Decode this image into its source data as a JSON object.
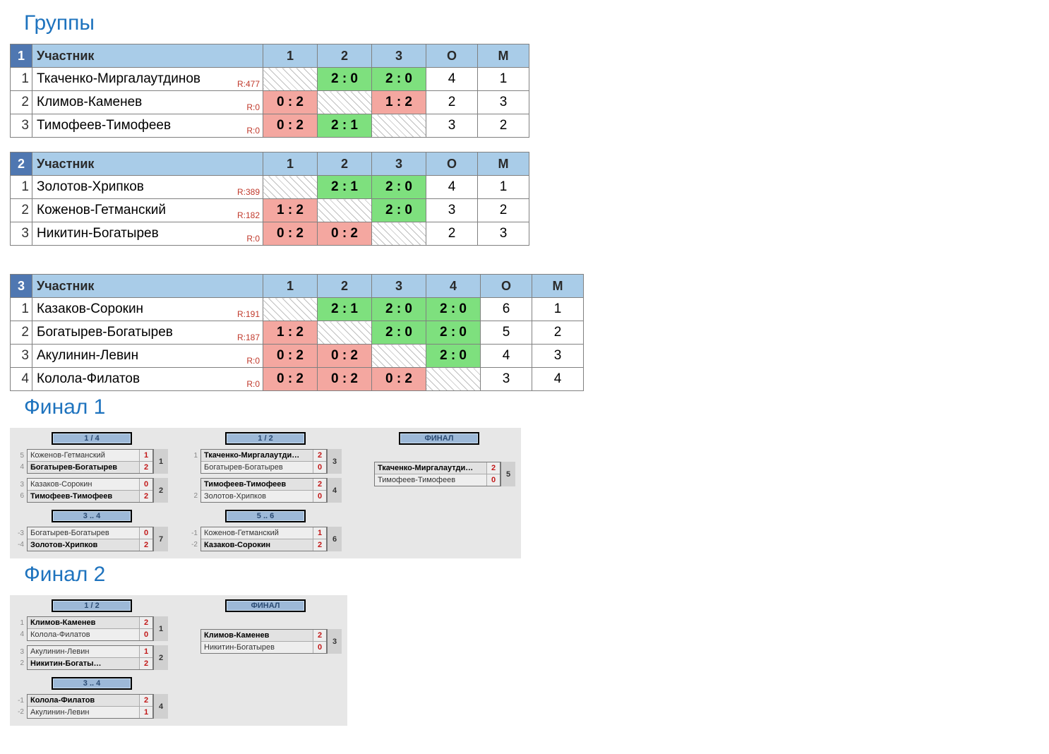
{
  "sections": {
    "groups": "Группы",
    "final1": "Финал 1",
    "final2": "Финал 2"
  },
  "headers": {
    "participant": "Участник",
    "o": "О",
    "m": "М"
  },
  "groups": [
    {
      "number": "1",
      "cols": [
        "1",
        "2",
        "3"
      ],
      "rows": [
        {
          "idx": "1",
          "name": "Ткаченко-Миргалаутдинов",
          "rating": "R:477",
          "cells": [
            {
              "t": "diag"
            },
            {
              "t": "win",
              "v": "2 : 0"
            },
            {
              "t": "win",
              "v": "2 : 0"
            }
          ],
          "o": "4",
          "m": "1"
        },
        {
          "idx": "2",
          "name": "Климов-Каменев",
          "rating": "R:0",
          "cells": [
            {
              "t": "lose",
              "v": "0 : 2"
            },
            {
              "t": "diag"
            },
            {
              "t": "lose",
              "v": "1 : 2"
            }
          ],
          "o": "2",
          "m": "3"
        },
        {
          "idx": "3",
          "name": "Тимофеев-Тимофеев",
          "rating": "R:0",
          "cells": [
            {
              "t": "lose",
              "v": "0 : 2"
            },
            {
              "t": "win",
              "v": "2 : 1"
            },
            {
              "t": "diag"
            }
          ],
          "o": "3",
          "m": "2"
        }
      ]
    },
    {
      "number": "2",
      "cols": [
        "1",
        "2",
        "3"
      ],
      "rows": [
        {
          "idx": "1",
          "name": "Золотов-Хрипков",
          "rating": "R:389",
          "cells": [
            {
              "t": "diag"
            },
            {
              "t": "win",
              "v": "2 : 1"
            },
            {
              "t": "win",
              "v": "2 : 0"
            }
          ],
          "o": "4",
          "m": "1"
        },
        {
          "idx": "2",
          "name": "Коженов-Гетманский",
          "rating": "R:182",
          "cells": [
            {
              "t": "lose",
              "v": "1 : 2"
            },
            {
              "t": "diag"
            },
            {
              "t": "win",
              "v": "2 : 0"
            }
          ],
          "o": "3",
          "m": "2"
        },
        {
          "idx": "3",
          "name": "Никитин-Богатырев",
          "rating": "R:0",
          "cells": [
            {
              "t": "lose",
              "v": "0 : 2"
            },
            {
              "t": "lose",
              "v": "0 : 2"
            },
            {
              "t": "diag"
            }
          ],
          "o": "2",
          "m": "3"
        }
      ]
    },
    {
      "number": "3",
      "cols": [
        "1",
        "2",
        "3",
        "4"
      ],
      "rows": [
        {
          "idx": "1",
          "name": "Казаков-Сорокин",
          "rating": "R:191",
          "cells": [
            {
              "t": "diag"
            },
            {
              "t": "win",
              "v": "2 : 1"
            },
            {
              "t": "win",
              "v": "2 : 0"
            },
            {
              "t": "win",
              "v": "2 : 0"
            }
          ],
          "o": "6",
          "m": "1"
        },
        {
          "idx": "2",
          "name": "Богатырев-Богатырев",
          "rating": "R:187",
          "cells": [
            {
              "t": "lose",
              "v": "1 : 2"
            },
            {
              "t": "diag"
            },
            {
              "t": "win",
              "v": "2 : 0"
            },
            {
              "t": "win",
              "v": "2 : 0"
            }
          ],
          "o": "5",
          "m": "2"
        },
        {
          "idx": "3",
          "name": "Акулинин-Левин",
          "rating": "R:0",
          "cells": [
            {
              "t": "lose",
              "v": "0 : 2"
            },
            {
              "t": "lose",
              "v": "0 : 2"
            },
            {
              "t": "diag"
            },
            {
              "t": "win",
              "v": "2 : 0"
            }
          ],
          "o": "4",
          "m": "3"
        },
        {
          "idx": "4",
          "name": "Колола-Филатов",
          "rating": "R:0",
          "cells": [
            {
              "t": "lose",
              "v": "0 : 2"
            },
            {
              "t": "lose",
              "v": "0 : 2"
            },
            {
              "t": "lose",
              "v": "0 : 2"
            },
            {
              "t": "diag"
            }
          ],
          "o": "3",
          "m": "4"
        }
      ]
    }
  ],
  "final1": {
    "row1": [
      {
        "label": "1 / 4",
        "center": false,
        "matches": [
          {
            "num": "1",
            "a": {
              "seed": "5",
              "name": "Коженов-Гетманский",
              "score": "1",
              "win": false
            },
            "b": {
              "seed": "4",
              "name": "Богатырев-Богатырев",
              "score": "2",
              "win": true
            }
          },
          {
            "num": "2",
            "a": {
              "seed": "3",
              "name": "Казаков-Сорокин",
              "score": "0",
              "win": false
            },
            "b": {
              "seed": "6",
              "name": "Тимофеев-Тимофеев",
              "score": "2",
              "win": true
            }
          }
        ]
      },
      {
        "label": "1 / 2",
        "center": false,
        "matches": [
          {
            "num": "3",
            "a": {
              "seed": "1",
              "name": "Ткаченко-Миргалаутди…",
              "score": "2",
              "win": true
            },
            "b": {
              "seed": "",
              "name": "Богатырев-Богатырев",
              "score": "0",
              "win": false
            }
          },
          {
            "num": "4",
            "a": {
              "seed": "",
              "name": "Тимофеев-Тимофеев",
              "score": "2",
              "win": true
            },
            "b": {
              "seed": "2",
              "name": "Золотов-Хрипков",
              "score": "0",
              "win": false
            }
          }
        ]
      },
      {
        "label": "ФИНАЛ",
        "center": true,
        "matches": [
          {
            "num": "5",
            "a": {
              "seed": "",
              "name": "Ткаченко-Миргалаутди…",
              "score": "2",
              "win": true
            },
            "b": {
              "seed": "",
              "name": "Тимофеев-Тимофеев",
              "score": "0",
              "win": false
            }
          }
        ]
      }
    ],
    "row2": [
      {
        "label": "3 .. 4",
        "center": false,
        "matches": [
          {
            "num": "7",
            "a": {
              "seed": "-3",
              "name": "Богатырев-Богатырев",
              "score": "0",
              "win": false
            },
            "b": {
              "seed": "-4",
              "name": "Золотов-Хрипков",
              "score": "2",
              "win": true
            }
          }
        ]
      },
      {
        "label": "5 .. 6",
        "center": false,
        "matches": [
          {
            "num": "6",
            "a": {
              "seed": "-1",
              "name": "Коженов-Гетманский",
              "score": "1",
              "win": false
            },
            "b": {
              "seed": "-2",
              "name": "Казаков-Сорокин",
              "score": "2",
              "win": true
            }
          }
        ]
      }
    ]
  },
  "final2": {
    "row1": [
      {
        "label": "1 / 2",
        "center": false,
        "matches": [
          {
            "num": "1",
            "a": {
              "seed": "1",
              "name": "Климов-Каменев",
              "score": "2",
              "win": true
            },
            "b": {
              "seed": "4",
              "name": "Колола-Филатов",
              "score": "0",
              "win": false
            }
          },
          {
            "num": "2",
            "a": {
              "seed": "3",
              "name": "Акулинин-Левин",
              "score": "1",
              "win": false
            },
            "b": {
              "seed": "2",
              "name": "Никитин-Богаты…",
              "score": "2",
              "win": true
            }
          }
        ]
      },
      {
        "label": "ФИНАЛ",
        "center": true,
        "matches": [
          {
            "num": "3",
            "a": {
              "seed": "",
              "name": "Климов-Каменев",
              "score": "2",
              "win": true
            },
            "b": {
              "seed": "",
              "name": "Никитин-Богатырев",
              "score": "0",
              "win": false
            }
          }
        ]
      }
    ],
    "row2": [
      {
        "label": "3 .. 4",
        "center": false,
        "matches": [
          {
            "num": "4",
            "a": {
              "seed": "-1",
              "name": "Колола-Филатов",
              "score": "2",
              "win": true
            },
            "b": {
              "seed": "-2",
              "name": "Акулинин-Левин",
              "score": "1",
              "win": false
            }
          }
        ]
      }
    ]
  }
}
